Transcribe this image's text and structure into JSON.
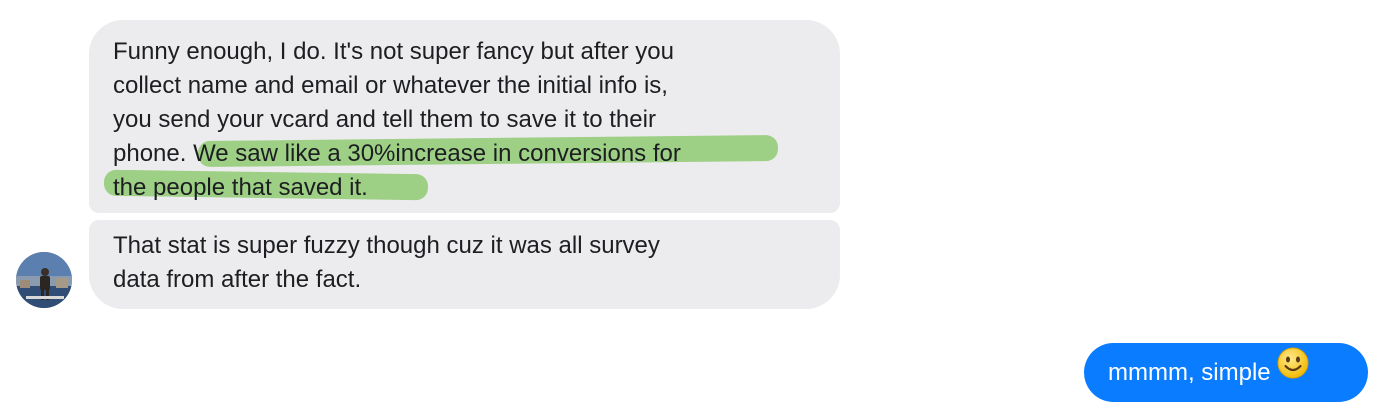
{
  "conversation": {
    "received": [
      {
        "lines": [
          "Funny enough, I do. It's not super fancy but after you",
          "collect name and email or whatever the initial info is,",
          "you send your vcard and tell them to save it to their"
        ],
        "line4_prefix": "phone.",
        "highlighted_line1": " We saw like a 30%increase in conversions for",
        "highlighted_line2": "the people that saved it."
      },
      {
        "lines": [
          "That stat is super fuzzy though cuz it was all survey",
          "data from after the fact."
        ]
      }
    ],
    "sent": {
      "text": "mmmm, simple",
      "emoji": "smiling-face-emoji"
    }
  },
  "colors": {
    "received_bubble": "#ecebed",
    "sent_bubble": "#0a7cff",
    "highlight": "#7ec45c",
    "text": "#1c1e21"
  }
}
